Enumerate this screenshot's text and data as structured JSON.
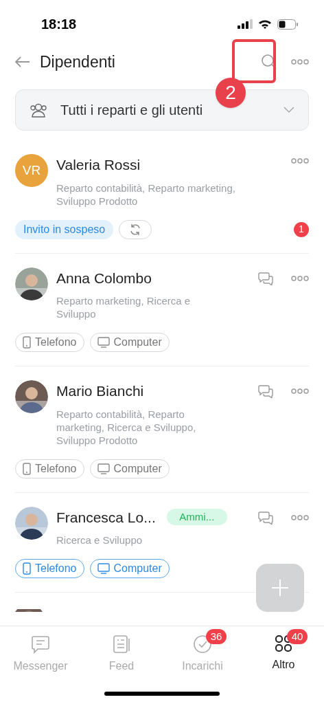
{
  "status_bar": {
    "time": "18:18"
  },
  "header": {
    "title": "Dipendenti",
    "annotation": {
      "label": "2"
    }
  },
  "filter": {
    "label": "Tutti i reparti e gli utenti"
  },
  "users": [
    {
      "name": "Valeria Rossi",
      "avatar": {
        "kind": "initials",
        "initials": "VR",
        "color": "#e8a33d"
      },
      "departments": "Reparto contabilità, Reparto marketing, Sviluppo Prodotto",
      "chat": false,
      "invite": {
        "label": "Invito in sospeso",
        "count": "1"
      }
    },
    {
      "name": "Anna Colombo",
      "departments": "Reparto marketing, Ricerca e Sviluppo",
      "chat": true,
      "devices": [
        {
          "kind": "phone",
          "label": "Telefono",
          "active": false
        },
        {
          "kind": "computer",
          "label": "Computer",
          "active": false
        }
      ]
    },
    {
      "name": "Mario Bianchi",
      "departments": "Reparto contabilità, Reparto marketing, Ricerca e Sviluppo, Sviluppo Prodotto",
      "chat": true,
      "devices": [
        {
          "kind": "phone",
          "label": "Telefono",
          "active": false
        },
        {
          "kind": "computer",
          "label": "Computer",
          "active": false
        }
      ]
    },
    {
      "name": "Francesca Lo...",
      "role": "Ammi...",
      "departments": "Ricerca e Sviluppo",
      "chat": true,
      "devices": [
        {
          "kind": "phone",
          "label": "Telefono",
          "active": true
        },
        {
          "kind": "computer",
          "label": "Computer",
          "active": true
        }
      ]
    }
  ],
  "tabs": [
    {
      "kind": "messenger",
      "label": "Messenger",
      "selected": false
    },
    {
      "kind": "feed",
      "label": "Feed",
      "selected": false
    },
    {
      "kind": "tasks",
      "label": "Incarichi",
      "badge": "36",
      "selected": false
    },
    {
      "kind": "more",
      "label": "Altro",
      "badge": "40",
      "selected": true
    }
  ]
}
